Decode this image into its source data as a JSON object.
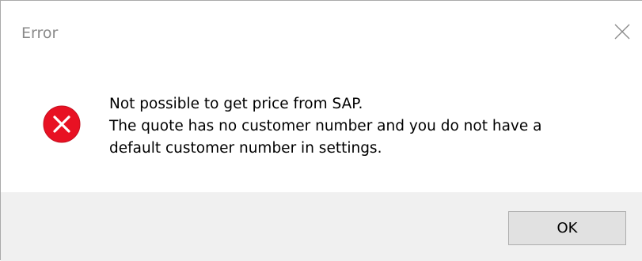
{
  "window": {
    "title": "Error",
    "close_icon": "close-icon"
  },
  "message": {
    "icon": "error-icon",
    "icon_color": "#e81123",
    "lines": [
      "Not possible to get price from SAP.",
      "The quote has no customer number and you do not have a",
      "default customer number in settings."
    ]
  },
  "buttons": {
    "ok_label": "OK"
  }
}
